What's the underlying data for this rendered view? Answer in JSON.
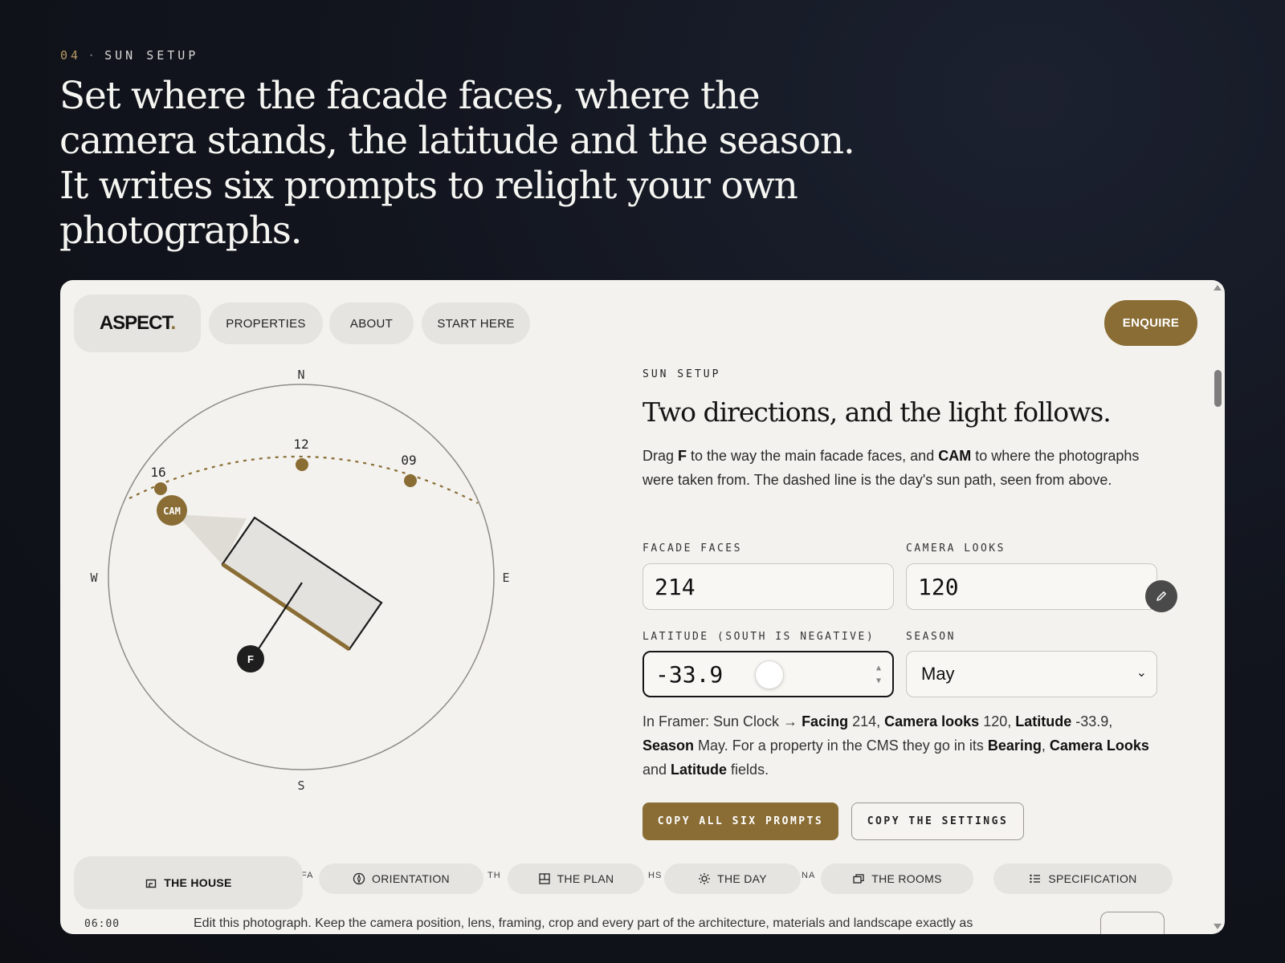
{
  "eyebrow": {
    "number": "04",
    "separator": "·",
    "label": "SUN SETUP"
  },
  "headline": "Set where the facade faces, where the camera stands, the latitude and the season. It writes six prompts to relight your own photographs.",
  "nav": {
    "logo_text": "ASPECT",
    "logo_dot": ".",
    "items": [
      "PROPERTIES",
      "ABOUT",
      "START HERE"
    ],
    "cta": "ENQUIRE"
  },
  "compass": {
    "north": "N",
    "south": "S",
    "east": "E",
    "west": "W",
    "hour_labels": [
      "16",
      "12",
      "09"
    ],
    "camera_label": "CAM",
    "facade_label": "F"
  },
  "panel": {
    "eyebrow": "SUN SETUP",
    "title": "Two directions, and the light follows.",
    "desc_1": "Drag ",
    "desc_f": "F",
    "desc_2": " to the way the main facade faces, and ",
    "desc_cam": "CAM",
    "desc_3": " to where the photographs were taken from. The dashed line is the day's sun path, seen from above.",
    "facade_label": "FACADE FACES",
    "facade_value": "214",
    "camera_label": "CAMERA LOOKS",
    "camera_value": "120",
    "latitude_label": "LATITUDE (SOUTH IS NEGATIVE)",
    "latitude_value": "-33.9",
    "season_label": "SEASON",
    "season_value": "May"
  },
  "note": {
    "p1": "In Framer: Sun Clock → ",
    "facing_k": "Facing",
    "facing_v": " 214, ",
    "camera_k": "Camera looks",
    "camera_v": " 120, ",
    "lat_k": "Latitude",
    "lat_v": " -33.9, ",
    "season_k": "Season",
    "season_v": " May. For a property in the CMS they go in its ",
    "bearing_k": "Bearing",
    "comma": ", ",
    "camlooks_k": "Camera Looks",
    "and": " and ",
    "latitude_k": "Latitude",
    "fields": " fields."
  },
  "buttons": {
    "copy_all": "COPY ALL SIX PROMPTS",
    "copy_settings": "COPY THE SETTINGS"
  },
  "tabs": [
    {
      "label": "THE HOUSE",
      "icon": "house-icon"
    },
    {
      "label": "ORIENTATION",
      "icon": "compass-icon"
    },
    {
      "label": "THE PLAN",
      "icon": "floorplan-icon"
    },
    {
      "label": "THE DAY",
      "icon": "sun-icon"
    },
    {
      "label": "THE ROOMS",
      "icon": "rooms-icon"
    },
    {
      "label": "SPECIFICATION",
      "icon": "list-icon"
    }
  ],
  "ghost_fragments": [
    "FA",
    "TH",
    "HS",
    "NA"
  ],
  "time_label": "06:00",
  "clipped_text": "Edit this photograph. Keep the camera position, lens, framing, crop and every part of the architecture, materials and landscape exactly as",
  "colors": {
    "accent": "#8a6d35",
    "background": "#0f1219",
    "surface": "#f3f2ee",
    "pill": "#e6e4e0"
  }
}
